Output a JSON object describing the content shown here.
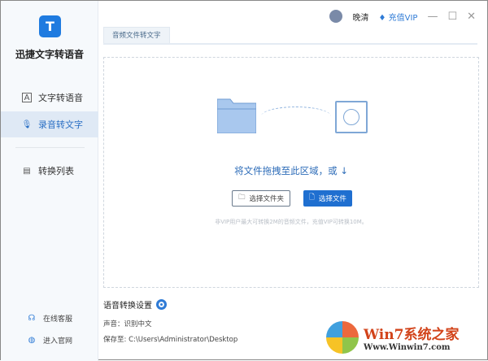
{
  "app": {
    "name": "迅捷文字转语音",
    "logo_letter": "T"
  },
  "sidebar": {
    "items": [
      {
        "label": "文字转语音",
        "icon": "text-a-icon"
      },
      {
        "label": "录音转文字",
        "icon": "microphone-icon",
        "active": true
      },
      {
        "label": "转换列表",
        "icon": "list-icon"
      }
    ],
    "bottom": [
      {
        "label": "在线客服",
        "icon": "headset-icon"
      },
      {
        "label": "进入官网",
        "icon": "globe-icon"
      }
    ]
  },
  "header": {
    "user": "晚清",
    "vip": "充值VIP",
    "minimize": "—",
    "maximize": "☐",
    "close": "✕"
  },
  "tab": "音频文件转文字",
  "drop": {
    "text": "将文件拖拽至此区域，或 ↓",
    "folder_button": "选择文件夹",
    "file_button": "选择文件",
    "hint": "非VIP用户最大可转换2M的音频文件，充值VIP可转换10M。"
  },
  "settings": {
    "title": "语音转换设置",
    "voice": "声音：识别中文",
    "save_to": "保存至: C:\\Users\\Administrator\\Desktop"
  },
  "watermark": {
    "title": "Win7系统之家",
    "url": "Www.Winwin7.com"
  }
}
